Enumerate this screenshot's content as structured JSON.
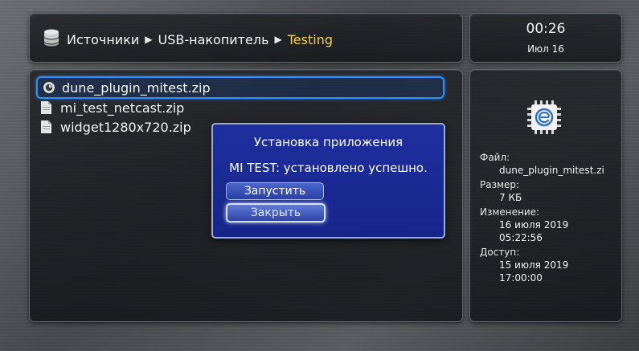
{
  "breadcrumb": {
    "items": [
      "Источники",
      "USB-накопитель"
    ],
    "current": "Testing"
  },
  "clock": {
    "time": "00:26",
    "date": "Июл 16"
  },
  "files": [
    {
      "name": "dune_plugin_mitest.zip",
      "icon": "plugin-icon",
      "selected": true
    },
    {
      "name": "mi_test_netcast.zip",
      "icon": "file-icon",
      "selected": false
    },
    {
      "name": "widget1280x720.zip",
      "icon": "file-icon",
      "selected": false
    }
  ],
  "dialog": {
    "title": "Установка приложения",
    "message": "MI TEST: установлено успешно.",
    "run_label": "Запустить",
    "close_label": "Закрыть"
  },
  "info": {
    "file_label": "Файл:",
    "file_value": "dune_plugin_mitest.zi",
    "size_label": "Размер:",
    "size_value": "7 КБ",
    "modified_label": "Изменение:",
    "modified_date": "16 июля 2019",
    "modified_time": "05:22:56",
    "access_label": "Доступ:",
    "access_date": "15 июля 2019",
    "access_time": "17:00:00"
  },
  "colors": {
    "accent_yellow": "#f5d24a",
    "dialog_blue": "#1e2f9e",
    "selection_blue": "#2f8fff"
  }
}
